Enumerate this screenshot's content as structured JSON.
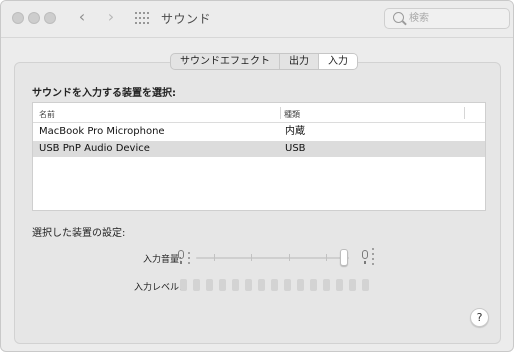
{
  "window": {
    "title": "サウンド",
    "back_glyph": "‹",
    "forward_glyph": "›",
    "search": {
      "placeholder": "検索",
      "value": ""
    }
  },
  "tabs": [
    {
      "label": "サウンドエフェクト",
      "active": false
    },
    {
      "label": "出力",
      "active": false
    },
    {
      "label": "入力",
      "active": true
    }
  ],
  "input_panel": {
    "select_label": "サウンドを入力する装置を選択:",
    "columns": [
      "名前",
      "種類"
    ],
    "devices": [
      {
        "name": "MacBook Pro Microphone",
        "type": "内蔵",
        "selected": false
      },
      {
        "name": "USB PnP Audio Device",
        "type": "USB",
        "selected": true
      }
    ],
    "settings_label": "選択した装置の設定:",
    "input_volume_label": "入力音量:",
    "input_volume_fraction": 0.97,
    "input_level_label": "入力レベル:",
    "input_level_segments": 15,
    "input_level_active": 0,
    "help_label": "?"
  },
  "colors": {
    "window_bg": "#ececec",
    "panel_bg": "#e6e6e6",
    "selected_row": "#dcdcdc"
  }
}
